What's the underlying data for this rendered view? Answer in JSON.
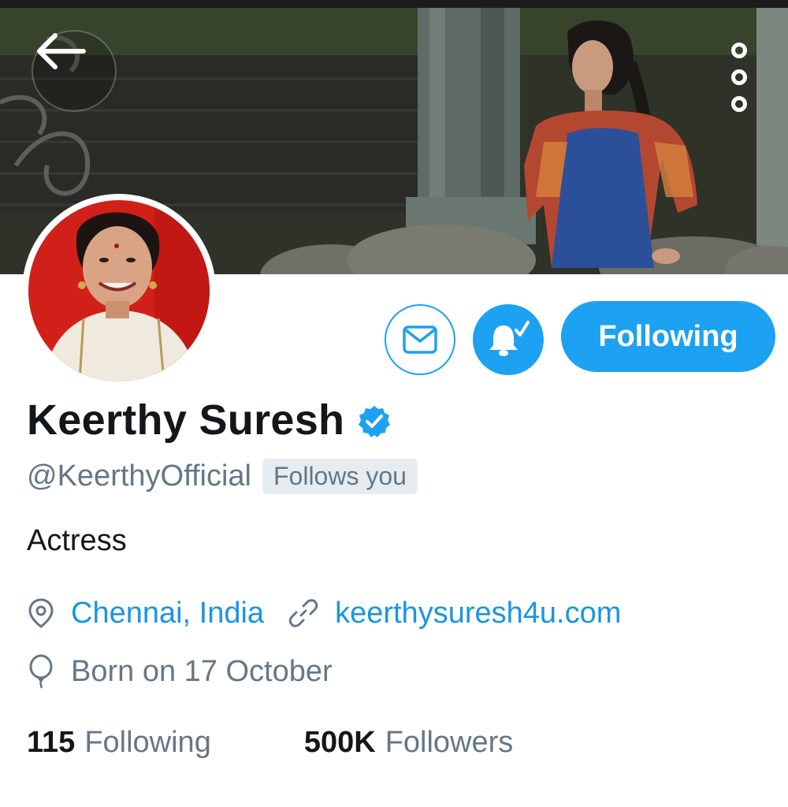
{
  "profile": {
    "name": "Keerthy Suresh",
    "handle": "@KeerthyOfficial",
    "follows_you": "Follows you",
    "bio": "Actress",
    "location": "Chennai, India",
    "website": "keerthysuresh4u.com",
    "birthday": "Born on 17 October",
    "verified": true
  },
  "actions": {
    "following_label": "Following",
    "message_icon": "envelope-icon",
    "notifications_icon": "bell-check-icon"
  },
  "stats": {
    "following_count": "115",
    "following_label": "Following",
    "followers_count": "500K",
    "followers_label": "Followers"
  },
  "icons": {
    "back": "back-arrow-icon",
    "more": "more-vertical-icon",
    "location": "location-pin-icon",
    "link": "link-icon",
    "birthday": "balloon-icon",
    "verified": "verified-badge-icon"
  },
  "colors": {
    "accent": "#1da1f2",
    "link": "#1b95e0",
    "muted": "#657786",
    "text": "#14171a",
    "badge_bg": "#e6ecf0"
  }
}
